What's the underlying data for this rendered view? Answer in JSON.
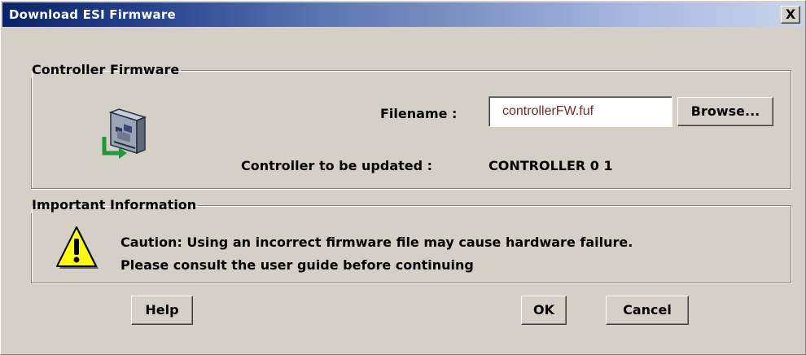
{
  "window": {
    "title": "Download ESI Firmware",
    "close_glyph": "X",
    "title_gradient": [
      "#0a246a",
      "#a6b8e0"
    ]
  },
  "controller_firmware": {
    "legend": "Controller Firmware",
    "icon": "controller-hardware-icon",
    "filename_label": "Filename :",
    "filename_value": "controllerFW.fuf",
    "browse_label": "Browse...",
    "controller_label": "Controller to be updated :",
    "controller_value": "CONTROLLER 0 1"
  },
  "important_information": {
    "legend": "Important Information",
    "icon": "warning-icon",
    "caution_line1": "Caution: Using an incorrect firmware file may cause hardware failure.",
    "caution_line2": "Please consult the user guide before continuing"
  },
  "buttons": {
    "help": "Help",
    "ok": "OK",
    "cancel": "Cancel"
  }
}
